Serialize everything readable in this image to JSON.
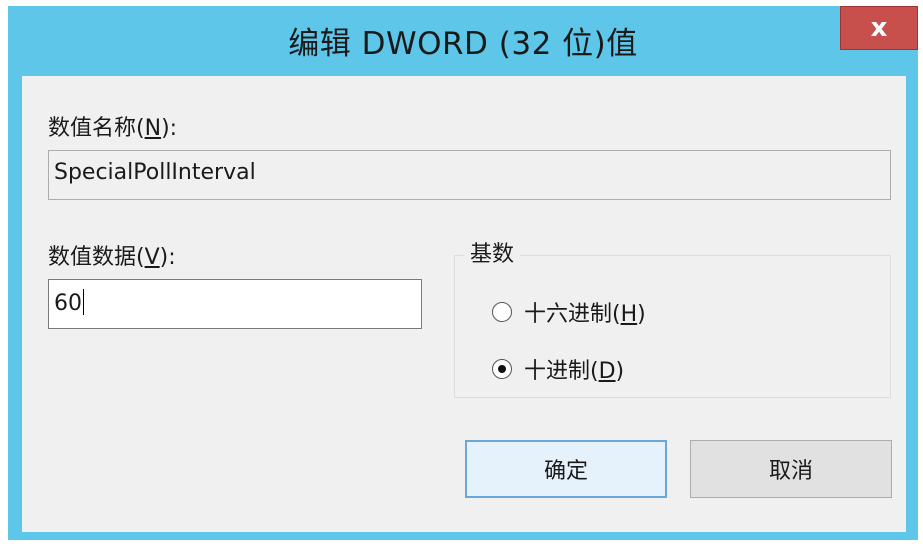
{
  "dialog": {
    "title": "编辑 DWORD (32 位)值",
    "close_glyph": "x"
  },
  "name": {
    "label_prefix": "数值名称(",
    "label_key": "N",
    "label_suffix": "):",
    "value": "SpecialPollInterval"
  },
  "data": {
    "label_prefix": "数值数据(",
    "label_key": "V",
    "label_suffix": "):",
    "value": "60"
  },
  "base": {
    "group_label": "基数",
    "options": [
      {
        "label_prefix": "十六进制(",
        "key": "H",
        "label_suffix": ")",
        "checked": false
      },
      {
        "label_prefix": "十进制(",
        "key": "D",
        "label_suffix": ")",
        "checked": true
      }
    ]
  },
  "buttons": {
    "ok": "确定",
    "cancel": "取消"
  },
  "colors": {
    "titlebar": "#5ec7e9",
    "close": "#c7504d",
    "client": "#f0f0f0",
    "ok_border": "#6aa6d8"
  }
}
